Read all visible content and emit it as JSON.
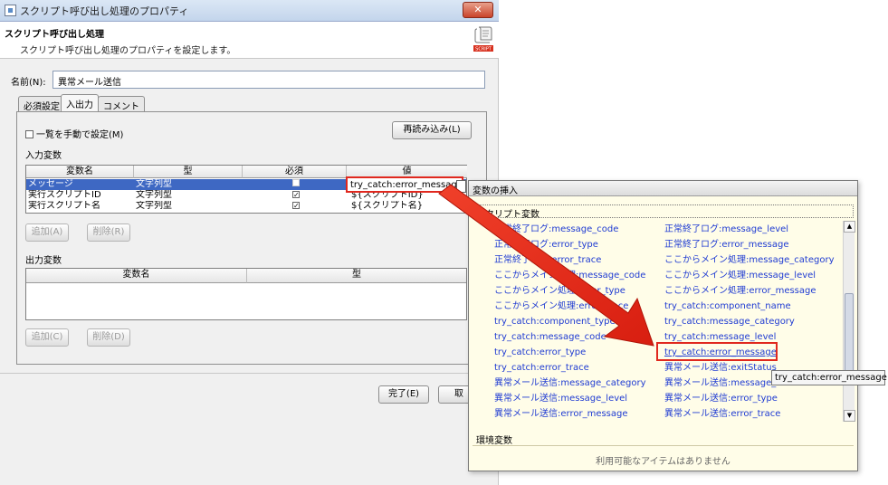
{
  "window": {
    "title": "スクリプト呼び出し処理のプロパティ",
    "close_glyph": "✕"
  },
  "header": {
    "title": "スクリプト呼び出し処理",
    "subtitle": "スクリプト呼び出し処理のプロパティを設定します。",
    "icon_caption": "SCRIPT"
  },
  "name_field": {
    "label": "名前(N):",
    "value": "異常メール送信"
  },
  "tabs": [
    {
      "label": "必須設定"
    },
    {
      "label": "入出力",
      "active": true
    },
    {
      "label": "コメント"
    }
  ],
  "input_section": {
    "manual_checkbox_label": "一覧を手動で設定(M)",
    "reload_button": "再読み込み(L)",
    "label": "入力変数",
    "columns": [
      "変数名",
      "型",
      "必須",
      "値"
    ],
    "rows": [
      {
        "name": "メッセージ",
        "type": "文字列型",
        "required": false,
        "value": ""
      },
      {
        "name": "実行スクリプトID",
        "type": "文字列型",
        "required": true,
        "value": "${スクリプトID}"
      },
      {
        "name": "実行スクリプト名",
        "type": "文字列型",
        "required": true,
        "value": "${スクリプト名}"
      }
    ],
    "editing_value": "try_catch:error_message}",
    "add_button": "追加(A)",
    "delete_button": "削除(R)"
  },
  "output_section": {
    "label": "出力変数",
    "columns": [
      "変数名",
      "型"
    ],
    "add_button": "追加(C)",
    "delete_button": "削除(D)"
  },
  "footer": {
    "done_button": "完了(E)",
    "cancel_button": "取"
  },
  "popup": {
    "title": "変数の挿入",
    "group_script": "スクリプト変数",
    "left_column": [
      "正常終了ログ:message_code",
      "正常終了ログ:error_type",
      "正常終了ログ:error_trace",
      "ここからメイン処理:message_code",
      "ここからメイン処理:error_type",
      "ここからメイン処理:error_trace",
      "try_catch:component_type",
      "try_catch:message_code",
      "try_catch:error_type",
      "try_catch:error_trace",
      "異常メール送信:message_category",
      "異常メール送信:message_level",
      "異常メール送信:error_message"
    ],
    "right_column": [
      "正常終了ログ:message_level",
      "正常終了ログ:error_message",
      "ここからメイン処理:message_category",
      "ここからメイン処理:message_level",
      "ここからメイン処理:error_message",
      "try_catch:component_name",
      "try_catch:message_category",
      "try_catch:message_level",
      "try_catch:error_message",
      "異常メール送信:exitStatus",
      "異常メール送信:message_code",
      "異常メール送信:error_type",
      "異常メール送信:error_trace"
    ],
    "group_env": "環境変数",
    "env_empty": "利用可能なアイテムはありません",
    "tooltip": "try_catch:error_message"
  },
  "colors": {
    "accent_red": "#e0281e",
    "link_blue": "#1f3bd2",
    "selection": "#3e68c3"
  }
}
